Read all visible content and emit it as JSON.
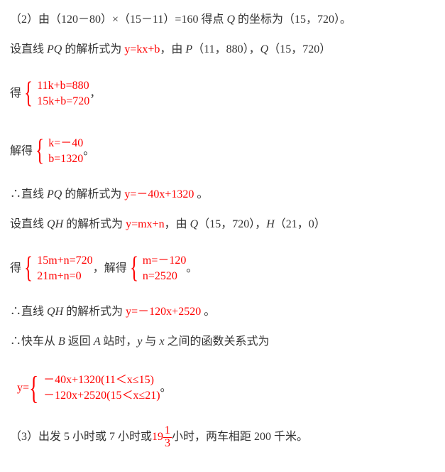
{
  "p1": {
    "a": "（2）由（120－80）×（15－11）=160 得点 ",
    "Q": "Q",
    "b": " 的坐标为（15，720）。"
  },
  "p2": {
    "a": "设直线 ",
    "PQ": "PQ",
    "b": " 的解析式为 ",
    "eq": "y=kx+b",
    "c": "，由 ",
    "P": "P",
    "pt1": "（11，880），",
    "Q": "Q",
    "pt2": "（15，720）"
  },
  "sys1": {
    "lead": "得 ",
    "r1": "11k+b=880",
    "r2": "15k+b=720",
    "tail": "，"
  },
  "sys1sol": {
    "lead": "解得",
    "r1": "k=－40",
    "r2": "b=1320",
    "tail": "。"
  },
  "p3": {
    "a": "∴直线 ",
    "PQ": "PQ",
    "b": " 的解析式为 ",
    "eq": "y=－40x+1320",
    "c": " 。"
  },
  "p4": {
    "a": "设直线 ",
    "QH": "QH",
    "b": " 的解析式为 ",
    "eq": "y=mx+n",
    "c": "，由 ",
    "Q": "Q",
    "pt1": "（15，720），",
    "H": "H",
    "pt2": "（21，0）"
  },
  "sys2": {
    "lead": "得 ",
    "r1": "15m+n=720",
    "r2": "21m+n=0",
    "mid": "，解得",
    "s1": "m=－120",
    "s2": "n=2520",
    "tail": " 。"
  },
  "p5": {
    "a": "∴直线 ",
    "QH": "QH",
    "b": " 的解析式为 ",
    "eq": "y=－120x+2520",
    "c": " 。"
  },
  "p6": {
    "a": "∴快车从 ",
    "B": "B",
    "b": " 返回 ",
    "A": " A ",
    "c": "站时，",
    "y": "y",
    "d": " 与 ",
    "x": "x",
    "e": " 之间的函数关系式为"
  },
  "piece": {
    "yeq": "y=",
    "r1a": "－40x+1320",
    "r1b": "(11＜x≤15)",
    "r2a": "－120x+2520",
    "r2b": "(15＜x≤21)",
    "tail": "。"
  },
  "p7": {
    "a": "（3）出发 5 小时或 7 小时或",
    "whole": "19",
    "num": "1",
    "den": "3",
    "b": "小时，两车相距 200 千米。"
  }
}
